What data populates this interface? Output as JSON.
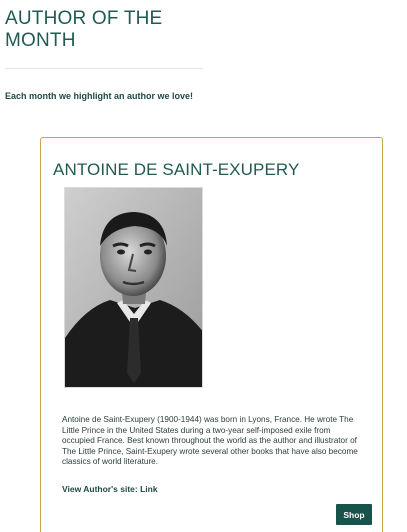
{
  "header": {
    "title": "AUTHOR OF THE MONTH",
    "intro": "Each month we highlight an author we love!"
  },
  "author": {
    "name": "ANTOINE DE SAINT-EXUPERY",
    "bio": "Antoine de Saint-Exupery (1900-1944) was born in Lyons, France. He wrote The Little Prince in the United States during a two-year self-imposed exile from occupied France. Best known throughout the world as the author and illustrator of The Little Prince, Saint-Exupery wrote several other books that have also become classics of world literature.",
    "site_label": "View Author's site: ",
    "site_link": "Link",
    "shop_label": "Shop"
  },
  "colors": {
    "accent": "#1f5b53",
    "card_border": "#c9a44a",
    "button_bg": "#17534b"
  },
  "icons": {
    "portrait": "author-portrait-photo"
  }
}
